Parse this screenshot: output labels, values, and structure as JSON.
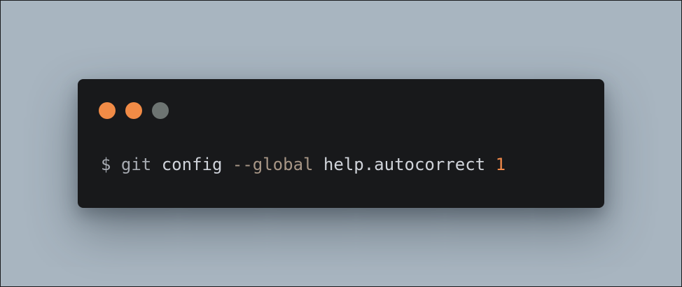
{
  "colors": {
    "background": "#a8b5c0",
    "window": "#18191b",
    "dot_1": "#f18b46",
    "dot_2": "#f18b46",
    "dot_3": "#6d7472",
    "prompt": "#a6aab1",
    "command": "#a6aab1",
    "keyword": "#cfd3da",
    "flag": "#a79686",
    "argument": "#d0d4da",
    "number": "#f0894a"
  },
  "window_controls": [
    {
      "icon": "window-dot-icon",
      "color": "#f18b46"
    },
    {
      "icon": "window-dot-icon",
      "color": "#f18b46"
    },
    {
      "icon": "window-dot-icon",
      "color": "#6d7472"
    }
  ],
  "terminal": {
    "prompt": "$",
    "command": "git",
    "subcommand": "config",
    "flag": "--global",
    "key": "help.autocorrect",
    "value": "1"
  }
}
